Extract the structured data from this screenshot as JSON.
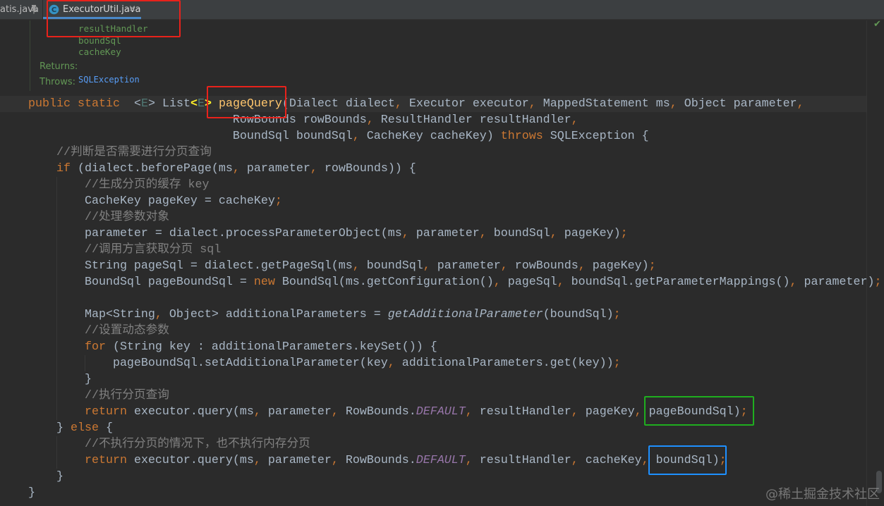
{
  "tabs": [
    {
      "label": "atis.java",
      "icon": "pin-icon"
    },
    {
      "label": "ExecutorUtil.java",
      "icon": "java-class-icon",
      "icon_letter": "C",
      "close": "×",
      "active": true
    }
  ],
  "javadoc": {
    "params": [
      "resultHandler",
      "boundSql",
      "cacheKey"
    ],
    "returns_label": "Returns:",
    "throws_label": "Throws:",
    "throws_value": "SQLException"
  },
  "code": {
    "lines": [
      [
        [
          "public",
          "kw"
        ],
        [
          " ",
          "tx"
        ],
        [
          "static",
          "kw"
        ],
        [
          "  <",
          "tx"
        ],
        [
          "E",
          "tp"
        ],
        [
          "> List",
          "tx"
        ],
        [
          "<",
          "br"
        ],
        [
          "E",
          "tp"
        ],
        [
          ">",
          "br"
        ],
        [
          " ",
          "tx"
        ],
        [
          "pageQuery",
          "md"
        ],
        [
          "(Dialect dialect",
          "tx"
        ],
        [
          ",",
          "pu"
        ],
        [
          " Executor executor",
          "tx"
        ],
        [
          ",",
          "pu"
        ],
        [
          " MappedStatement ms",
          "tx"
        ],
        [
          ",",
          "pu"
        ],
        [
          " Object parameter",
          "tx"
        ],
        [
          ",",
          "pu"
        ]
      ],
      [
        [
          "                             RowBounds rowBounds",
          "tx"
        ],
        [
          ",",
          "pu"
        ],
        [
          " ResultHandler resultHandler",
          "tx"
        ],
        [
          ",",
          "pu"
        ]
      ],
      [
        [
          "                             BoundSql boundSql",
          "tx"
        ],
        [
          ",",
          "pu"
        ],
        [
          " CacheKey cacheKey) ",
          "tx"
        ],
        [
          "throws",
          "kw"
        ],
        [
          " SQLException {",
          "tx"
        ]
      ],
      [
        [
          "    //判断是否需要进行分页查询",
          "cm"
        ]
      ],
      [
        [
          "    ",
          "tx"
        ],
        [
          "if",
          "kw"
        ],
        [
          " (dialect.beforePage(ms",
          "tx"
        ],
        [
          ",",
          "pu"
        ],
        [
          " parameter",
          "tx"
        ],
        [
          ",",
          "pu"
        ],
        [
          " rowBounds)) {",
          "tx"
        ]
      ],
      [
        [
          "        //生成分页的缓存 key",
          "cm"
        ]
      ],
      [
        [
          "        CacheKey pageKey = cacheKey",
          "tx"
        ],
        [
          ";",
          "pu"
        ]
      ],
      [
        [
          "        //处理参数对象",
          "cm"
        ]
      ],
      [
        [
          "        parameter = dialect.processParameterObject(ms",
          "tx"
        ],
        [
          ",",
          "pu"
        ],
        [
          " parameter",
          "tx"
        ],
        [
          ",",
          "pu"
        ],
        [
          " boundSql",
          "tx"
        ],
        [
          ",",
          "pu"
        ],
        [
          " pageKey)",
          "tx"
        ],
        [
          ";",
          "pu"
        ]
      ],
      [
        [
          "        //调用方言获取分页 sql",
          "cm"
        ]
      ],
      [
        [
          "        String pageSql = dialect.getPageSql(ms",
          "tx"
        ],
        [
          ",",
          "pu"
        ],
        [
          " boundSql",
          "tx"
        ],
        [
          ",",
          "pu"
        ],
        [
          " parameter",
          "tx"
        ],
        [
          ",",
          "pu"
        ],
        [
          " rowBounds",
          "tx"
        ],
        [
          ",",
          "pu"
        ],
        [
          " pageKey)",
          "tx"
        ],
        [
          ";",
          "pu"
        ]
      ],
      [
        [
          "        BoundSql pageBoundSql = ",
          "tx"
        ],
        [
          "new",
          "kw"
        ],
        [
          " BoundSql(ms.getConfiguration()",
          "tx"
        ],
        [
          ",",
          "pu"
        ],
        [
          " pageSql",
          "tx"
        ],
        [
          ",",
          "pu"
        ],
        [
          " boundSql.getParameterMappings()",
          "tx"
        ],
        [
          ",",
          "pu"
        ],
        [
          " parameter)",
          "tx"
        ],
        [
          ";",
          "pu"
        ]
      ],
      [],
      [
        [
          "        Map<String",
          "tx"
        ],
        [
          ",",
          "pu"
        ],
        [
          " Object> additionalParameters = ",
          "tx"
        ],
        [
          "getAdditionalParameter",
          "it"
        ],
        [
          "(boundSql)",
          "tx"
        ],
        [
          ";",
          "pu"
        ]
      ],
      [
        [
          "        //设置动态参数",
          "cm"
        ]
      ],
      [
        [
          "        ",
          "tx"
        ],
        [
          "for",
          "kw"
        ],
        [
          " (String key : additionalParameters.keySet()) {",
          "tx"
        ]
      ],
      [
        [
          "            pageBoundSql.setAdditionalParameter(key",
          "tx"
        ],
        [
          ",",
          "pu"
        ],
        [
          " additionalParameters.get(key))",
          "tx"
        ],
        [
          ";",
          "pu"
        ]
      ],
      [
        [
          "        }",
          "tx"
        ]
      ],
      [
        [
          "        //执行分页查询",
          "cm"
        ]
      ],
      [
        [
          "        ",
          "tx"
        ],
        [
          "return",
          "kw"
        ],
        [
          " executor.query(ms",
          "tx"
        ],
        [
          ",",
          "pu"
        ],
        [
          " parameter",
          "tx"
        ],
        [
          ",",
          "pu"
        ],
        [
          " RowBounds.",
          "tx"
        ],
        [
          "DEFAULT",
          "st"
        ],
        [
          ",",
          "pu"
        ],
        [
          " resultHandler",
          "tx"
        ],
        [
          ",",
          "pu"
        ],
        [
          " pageKey",
          "tx"
        ],
        [
          ",",
          "pu"
        ],
        [
          " pageBoundSql)",
          "tx"
        ],
        [
          ";",
          "pu"
        ]
      ],
      [
        [
          "    } ",
          "tx"
        ],
        [
          "else",
          "kw"
        ],
        [
          " {",
          "tx"
        ]
      ],
      [
        [
          "        //不执行分页的情况下，也不执行内存分页",
          "cm"
        ]
      ],
      [
        [
          "        ",
          "tx"
        ],
        [
          "return",
          "kw"
        ],
        [
          " executor.query(ms",
          "tx"
        ],
        [
          ",",
          "pu"
        ],
        [
          " parameter",
          "tx"
        ],
        [
          ",",
          "pu"
        ],
        [
          " RowBounds.",
          "tx"
        ],
        [
          "DEFAULT",
          "st"
        ],
        [
          ",",
          "pu"
        ],
        [
          " resultHandler",
          "tx"
        ],
        [
          ",",
          "pu"
        ],
        [
          " cacheKey",
          "tx"
        ],
        [
          ",",
          "pu"
        ],
        [
          " boundSql)",
          "tx"
        ],
        [
          ";",
          "pu"
        ]
      ],
      [
        [
          "    }",
          "tx"
        ]
      ],
      [
        [
          "}",
          "tx"
        ]
      ]
    ]
  },
  "status": {
    "inspection_icon": "check-icon"
  },
  "watermark": "@稀土掘金技术社区",
  "colors": {
    "keyword": "#cc7832",
    "text": "#a9b7c6",
    "comment": "#808080",
    "method": "#ffc66d",
    "type_param": "#507874",
    "brace_match": "#ffef28",
    "static_field": "#9876aa",
    "doc_green": "#629755",
    "link": "#589df6",
    "annotation_red": "#e8221b",
    "annotation_green": "#1fae1f",
    "annotation_blue": "#1e90ff"
  }
}
